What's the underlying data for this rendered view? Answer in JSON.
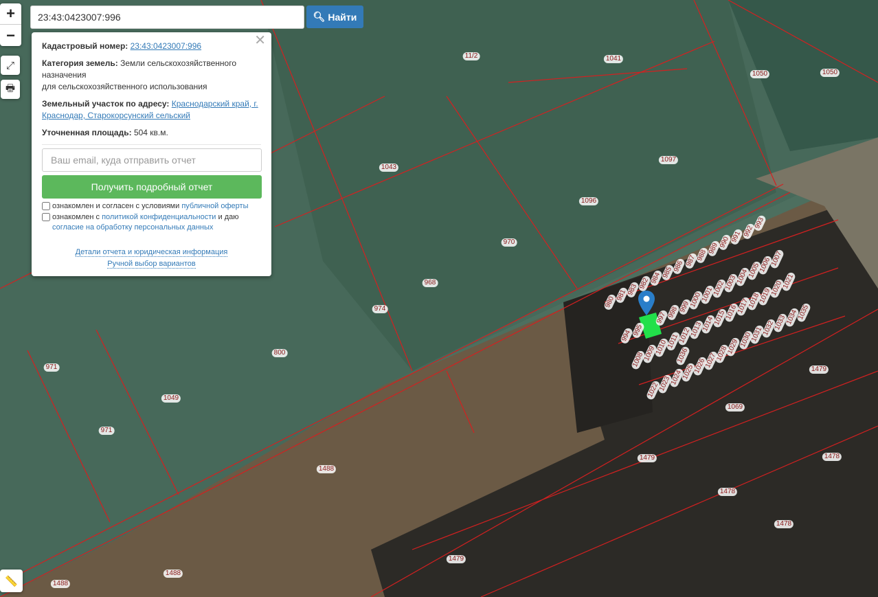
{
  "search": {
    "value": "23:43:0423007:996",
    "button": "Найти"
  },
  "controls": {
    "zoom_in": "+",
    "zoom_out": "−"
  },
  "popup": {
    "cad_label": "Кадастровый номер:",
    "cad_value": "23:43:0423007:996",
    "cat_label": "Категория земель:",
    "cat_value1": "Земли сельскохозяйственного назначения",
    "cat_value2": "для сельскохозяйственного использования",
    "addr_label": "Земельный участок по адресу:",
    "addr_value": "Краснодарский край, г. Краснодар, Старокорсунский сельский",
    "area_label": "Уточненная площадь:",
    "area_value": "504 кв.м.",
    "email_placeholder": "Ваш email, куда отправить отчет",
    "report_button": "Получить подробный отчет",
    "check1_text": "ознакомлен и согласен с условиями ",
    "check1_link": "публичной оферты",
    "check2_text": "ознакомлен с ",
    "check2_link": "политикой конфиденциальности",
    "check2_mid": " и даю ",
    "check2_link2": "согласие на обработку персональных данных",
    "link_details": "Детали отчета и юридическая информация",
    "link_manual": "Ручной выбор вариантов"
  },
  "parcels": [
    "11/2",
    "1041",
    "1050",
    "1050",
    "1043",
    "1097",
    "1096",
    "970",
    "968",
    "974",
    "800",
    "971",
    "1049",
    "971",
    "1069",
    "1479",
    "1479",
    "1478",
    "1478",
    "1478",
    "1488",
    "1479",
    "1488",
    "1488",
    "983",
    "992",
    "993",
    "991",
    "990",
    "989",
    "988",
    "987",
    "986",
    "985",
    "984",
    "982",
    "981",
    "980",
    "997",
    "998",
    "999",
    "1000",
    "1001",
    "1002",
    "1003",
    "1004",
    "1005",
    "1006",
    "1007",
    "1021",
    "1020",
    "1019",
    "1018",
    "1017",
    "1016",
    "1015",
    "1014",
    "1013",
    "1012",
    "1011",
    "1010",
    "1009",
    "1008",
    "994",
    "995",
    "1036",
    "1029",
    "1028",
    "1027",
    "1026",
    "1025",
    "1024",
    "1023",
    "1022",
    "1030",
    "1031",
    "1032",
    "1033",
    "1034",
    "1035"
  ]
}
